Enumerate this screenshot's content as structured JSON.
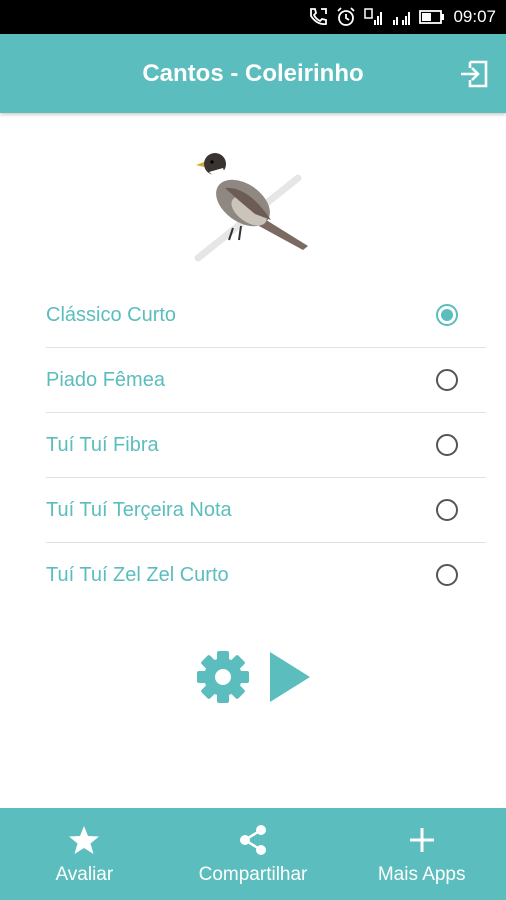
{
  "status_bar": {
    "time": "09:07"
  },
  "app_bar": {
    "title": "Cantos - Coleirinho"
  },
  "songs": [
    {
      "label": "Clássico Curto",
      "selected": true
    },
    {
      "label": "Piado Fêmea",
      "selected": false
    },
    {
      "label": "Tuí Tuí Fibra",
      "selected": false
    },
    {
      "label": "Tuí Tuí Terçeira Nota",
      "selected": false
    },
    {
      "label": "Tuí Tuí Zel Zel Curto",
      "selected": false
    }
  ],
  "controls": {
    "settings_icon": "gear-icon",
    "play_icon": "play-icon"
  },
  "bottom_nav": [
    {
      "label": "Avaliar",
      "icon": "star-icon"
    },
    {
      "label": "Compartilhar",
      "icon": "share-icon"
    },
    {
      "label": "Mais Apps",
      "icon": "plus-icon"
    }
  ],
  "colors": {
    "accent": "#5bbdbd",
    "status_bar": "#000000",
    "background": "#ffffff"
  }
}
